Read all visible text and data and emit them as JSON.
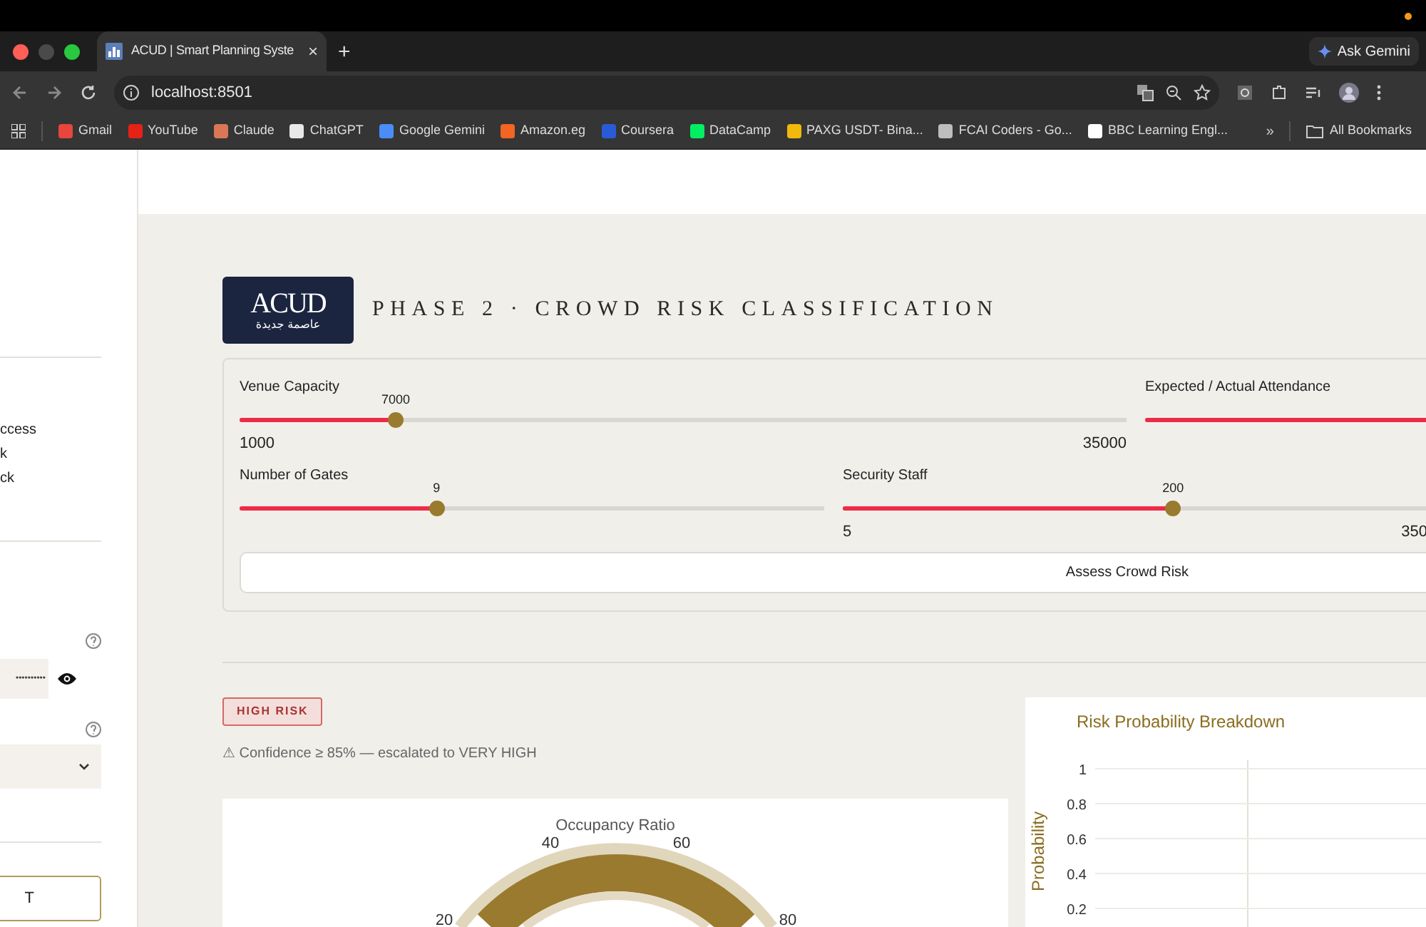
{
  "browser": {
    "tab_title": "ACUD | Smart Planning Syste",
    "tab_close": "×",
    "new_tab": "+",
    "address": "localhost:8501",
    "ask_gemini": "Ask Gemini",
    "bookmarks": [
      {
        "label": "Gmail",
        "color": "#e8453c"
      },
      {
        "label": "YouTube",
        "color": "#e62117"
      },
      {
        "label": "Claude",
        "color": "#d97757"
      },
      {
        "label": "ChatGPT",
        "color": "#e8e8e8"
      },
      {
        "label": "Google Gemini",
        "color": "#4b8df8"
      },
      {
        "label": "Amazon.eg",
        "color": "#f26522"
      },
      {
        "label": "Coursera",
        "color": "#2a5bd7"
      },
      {
        "label": "DataCamp",
        "color": "#03ef62"
      },
      {
        "label": "PAXG USDT- Bina...",
        "color": "#f0b90b"
      },
      {
        "label": "FCAI Coders - Go...",
        "color": "#bdbdbd"
      },
      {
        "label": "BBC Learning Engl...",
        "color": "#ffffff"
      }
    ],
    "more": "»",
    "all_bookmarks": "All Bookmarks"
  },
  "sidebar": {
    "options": [
      "ccess",
      "k",
      "ck"
    ],
    "password": "••••••••••",
    "button": "T"
  },
  "header": {
    "logo_latin": "ACUD",
    "logo_arabic": "عاصمة جديدة",
    "title": "PHASE 2 · CROWD RISK CLASSIFICATION"
  },
  "slider_rows": [
    [
      {
        "label": "Venue Capacity",
        "value": "7000",
        "min": "1000",
        "max": "35000",
        "level": 0.176
      },
      {
        "label": "Expected / Actual Attendance",
        "level": 1
      }
    ],
    [
      {
        "label": "Number of Gates",
        "value": "9",
        "level": 0.337
      },
      {
        "label": "Security Staff",
        "value": "200",
        "min": "5",
        "max": "350",
        "level": 0.565
      }
    ]
  ],
  "assess_button": "Assess Crowd Risk",
  "result": {
    "badge": "HIGH RISK",
    "note": "⚠ Confidence ≥ 85% — escalated to VERY HIGH"
  },
  "gauge": {
    "title": "Occupancy Ratio",
    "ticks": [
      "20",
      "40",
      "60",
      "80"
    ]
  },
  "chart": {
    "title": "Risk Probability Breakdown",
    "y_axis_label": "Probability",
    "y_ticks": [
      "1",
      "0.8",
      "0.6",
      "0.4",
      "0.2"
    ]
  }
}
